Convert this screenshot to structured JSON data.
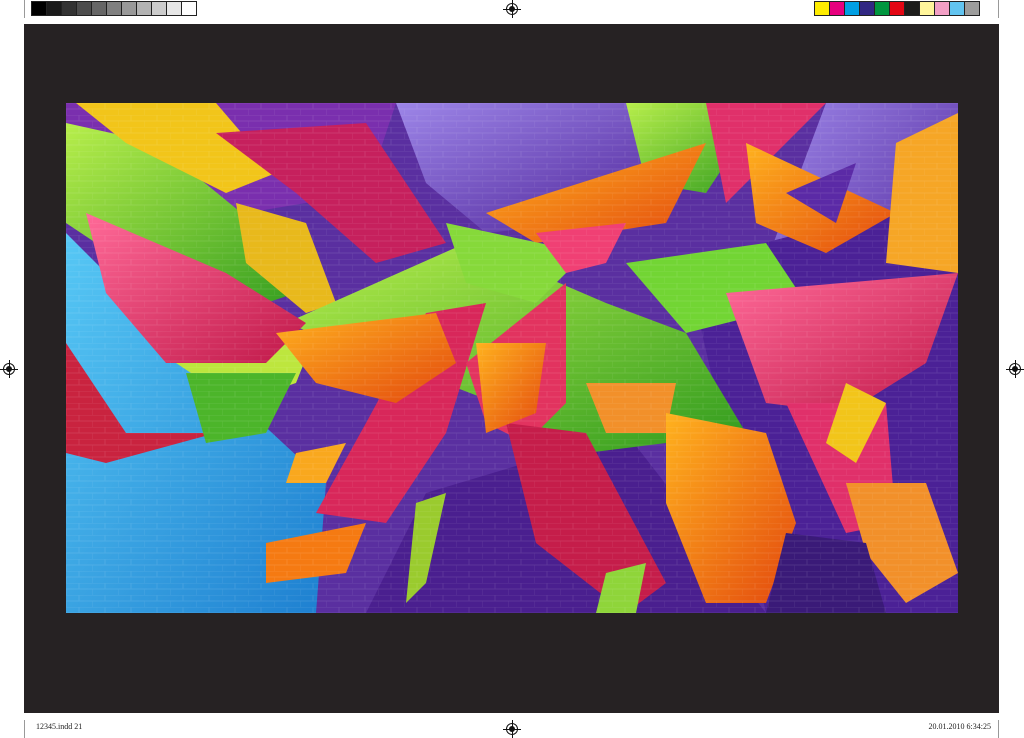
{
  "color_bars": {
    "grayscale": [
      "#000000",
      "#1a1a1a",
      "#333333",
      "#4d4d4d",
      "#666666",
      "#808080",
      "#999999",
      "#b3b3b3",
      "#cccccc",
      "#e6e6e6",
      "#ffffff"
    ],
    "process": [
      "#ffed00",
      "#e6007e",
      "#009fe3",
      "#312783",
      "#00963f",
      "#e30613",
      "#1d1d1b",
      "#fff59b",
      "#f29fc5",
      "#62c4f0",
      "#9d9d9c"
    ]
  },
  "artwork": {
    "subject": "graffiti-mural",
    "palette": {
      "violet": "#5b2aa6",
      "purple_light": "#8a6fd8",
      "magenta": "#e0306a",
      "pink": "#f2467f",
      "green": "#5fcf2a",
      "lime": "#a7e24a",
      "orange": "#f57a12",
      "yellow": "#f2c51a",
      "cyan": "#2fa6e6",
      "red": "#c21a3a"
    }
  },
  "slug": {
    "file_label": "12345.indd   21",
    "timestamp": "20.01.2010   6:34:25"
  }
}
